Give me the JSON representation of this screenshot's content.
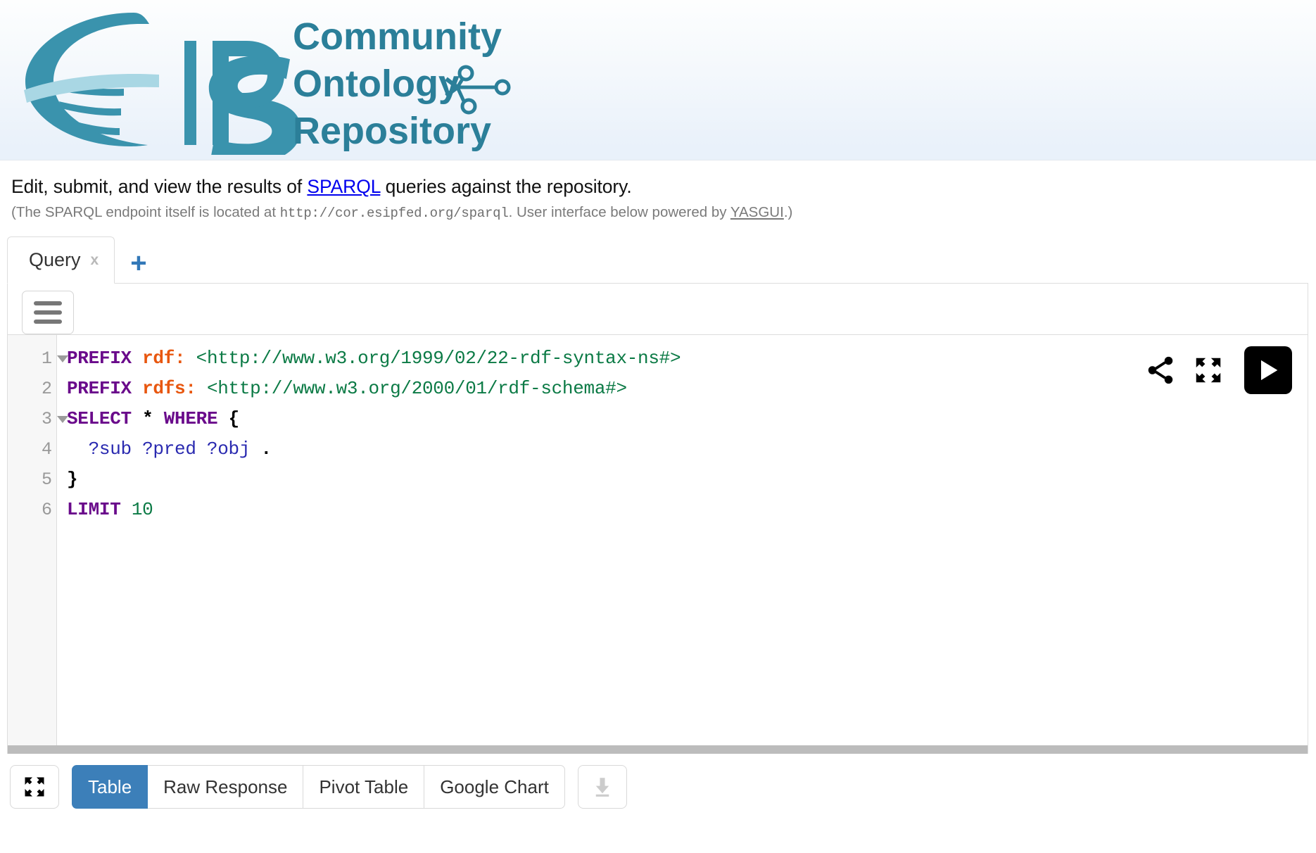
{
  "banner": {
    "logo_alt": "ESIP Community Ontology Repository logo",
    "brand_lines": [
      "Community",
      "Ontology",
      "Repository"
    ],
    "brand_color": "#3a93ad",
    "brand_dark": "#2b7f99",
    "background_top": "#fdfefe",
    "background_bottom": "#e9f1fa"
  },
  "intro": {
    "before_link": "Edit, submit, and view the results of ",
    "link_text": "SPARQL",
    "after_link": " queries against the repository.",
    "link_color": "#0000ee"
  },
  "subintro": {
    "part1": "(The SPARQL endpoint itself is located at ",
    "endpoint": "http://cor.esipfed.org/sparql",
    "part2": ". User interface below powered by ",
    "link_text": "YASGUI",
    "part3": ".)"
  },
  "tabs": {
    "items": [
      {
        "label": "Query",
        "close": "x",
        "active": true
      }
    ],
    "add_label": "+",
    "add_color": "#3278b8"
  },
  "editor": {
    "menu_icon": "hamburger-menu-icon",
    "share_icon": "share-icon",
    "fullscreen_icon": "fullscreen-expand-icon",
    "run_icon": "play-run-icon",
    "line_numbers": [
      "1",
      "2",
      "3",
      "4",
      "5",
      "6"
    ],
    "foldable_lines": [
      1,
      3
    ],
    "query_lines": [
      {
        "n": 1,
        "tokens": [
          {
            "t": "PREFIX ",
            "c": "k"
          },
          {
            "t": "rdf: ",
            "c": "p"
          },
          {
            "t": "<http://www.w3.org/1999/02/22-rdf-syntax-ns#>",
            "c": "u"
          }
        ]
      },
      {
        "n": 2,
        "tokens": [
          {
            "t": "PREFIX ",
            "c": "k"
          },
          {
            "t": "rdfs: ",
            "c": "p"
          },
          {
            "t": "<http://www.w3.org/2000/01/rdf-schema#>",
            "c": "u"
          }
        ]
      },
      {
        "n": 3,
        "tokens": [
          {
            "t": "SELECT ",
            "c": "k"
          },
          {
            "t": "* ",
            "c": "t"
          },
          {
            "t": "WHERE ",
            "c": "k"
          },
          {
            "t": "{",
            "c": "t"
          }
        ]
      },
      {
        "n": 4,
        "tokens": [
          {
            "t": "  ?sub ?pred ?obj ",
            "c": "v"
          },
          {
            "t": ".",
            "c": "t"
          }
        ]
      },
      {
        "n": 5,
        "tokens": [
          {
            "t": "}",
            "c": "t"
          }
        ]
      },
      {
        "n": 6,
        "tokens": [
          {
            "t": "LIMIT ",
            "c": "k"
          },
          {
            "t": "10",
            "c": "n"
          }
        ]
      }
    ],
    "query_text": "PREFIX rdf: <http://www.w3.org/1999/02/22-rdf-syntax-ns#>\nPREFIX rdfs: <http://www.w3.org/2000/01/rdf-schema#>\nSELECT * WHERE {\n  ?sub ?pred ?obj .\n}\nLIMIT 10",
    "syntax_colors": {
      "keyword": "#6a0a8b",
      "prefix": "#e8570f",
      "uri": "#0b7a45",
      "variable": "#2a2ab0",
      "number": "#0b7a45",
      "punct": "#000000"
    }
  },
  "results": {
    "fullscreen_icon": "fullscreen-expand-icon",
    "download_icon": "download-icon",
    "tabs": [
      {
        "label": "Table",
        "active": true
      },
      {
        "label": "Raw Response",
        "active": false
      },
      {
        "label": "Pivot Table",
        "active": false
      },
      {
        "label": "Google Chart",
        "active": false
      }
    ],
    "active_color": "#3c7fb9"
  }
}
